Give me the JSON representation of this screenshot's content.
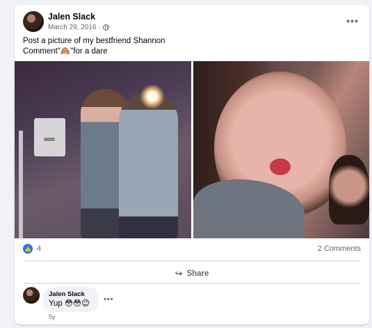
{
  "post": {
    "author": "Jalen Slack",
    "date": "March 29, 2016",
    "separator": "·",
    "text_line1": "Post a picture of my bestfriend Shannon",
    "text_line2": "Comment\"🙈\"for a dare",
    "menu_dots": "•••"
  },
  "stats": {
    "like_count": "4",
    "comments": "2 Comments"
  },
  "actions": {
    "share_label": "Share",
    "share_icon": "↪"
  },
  "comment": {
    "author": "Jalen Slack",
    "text": "Yup 😳😳😉",
    "time": "5y",
    "menu_dots": "•••"
  },
  "icons": {
    "like": "👍",
    "globe": "globe-icon"
  },
  "colors": {
    "accent": "#1877f2",
    "secondary_text": "#65676b",
    "background": "#f0f2f5"
  }
}
